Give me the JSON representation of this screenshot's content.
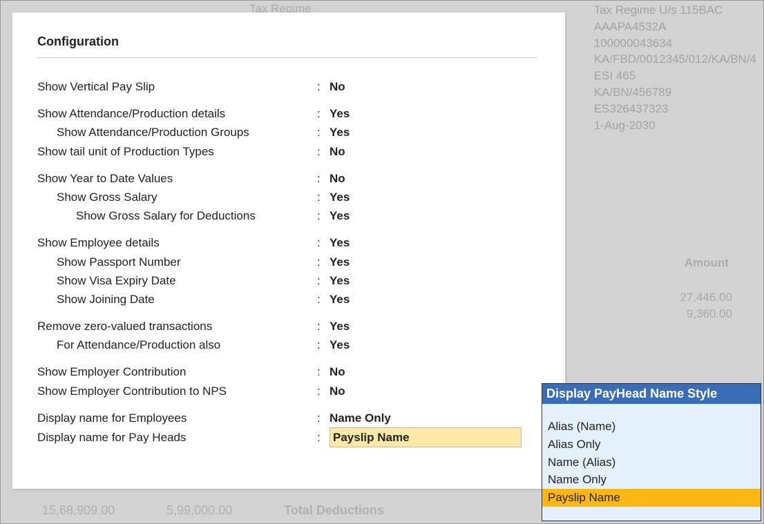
{
  "background": {
    "top_left_label": "Tax Regime",
    "right_lines": [
      "Tax Regime U/s 115BAC",
      "AAAPA4532A",
      "100000043634",
      "KA/FBD/0012345/012/KA/BN/4",
      "ESI 465",
      "KA/BN/456789",
      "ES326437323",
      "1-Aug-2030"
    ],
    "amount_header": "Amount",
    "amounts": [
      "27,446.00",
      "9,360.00"
    ],
    "bottom": {
      "a": "15,68,909.00",
      "b": "5,99,000.00",
      "label": "Total Deductions"
    }
  },
  "modal": {
    "title": "Configuration",
    "rows": [
      {
        "label": "Show Vertical Pay Slip",
        "value": "No",
        "indent": 0,
        "gap": false
      },
      {
        "label": "Show Attendance/Production details",
        "value": "Yes",
        "indent": 0,
        "gap": true
      },
      {
        "label": "Show Attendance/Production Groups",
        "value": "Yes",
        "indent": 1,
        "gap": false
      },
      {
        "label": "Show tail unit of Production Types",
        "value": "No",
        "indent": 0,
        "gap": false
      },
      {
        "label": "Show Year to Date Values",
        "value": "No",
        "indent": 0,
        "gap": true
      },
      {
        "label": "Show Gross Salary",
        "value": "Yes",
        "indent": 1,
        "gap": false
      },
      {
        "label": "Show Gross Salary for Deductions",
        "value": "Yes",
        "indent": 2,
        "gap": false
      },
      {
        "label": "Show Employee details",
        "value": "Yes",
        "indent": 0,
        "gap": true
      },
      {
        "label": "Show Passport Number",
        "value": "Yes",
        "indent": 1,
        "gap": false
      },
      {
        "label": "Show Visa Expiry Date",
        "value": "Yes",
        "indent": 1,
        "gap": false
      },
      {
        "label": "Show Joining Date",
        "value": "Yes",
        "indent": 1,
        "gap": false
      },
      {
        "label": "Remove zero-valued transactions",
        "value": "Yes",
        "indent": 0,
        "gap": true
      },
      {
        "label": "For Attendance/Production also",
        "value": "Yes",
        "indent": 1,
        "gap": false
      },
      {
        "label": "Show Employer Contribution",
        "value": "No",
        "indent": 0,
        "gap": true
      },
      {
        "label": "Show Employer Contribution to NPS",
        "value": "No",
        "indent": 0,
        "gap": false
      },
      {
        "label": "Display name for Employees",
        "value": "Name Only",
        "indent": 0,
        "gap": true
      },
      {
        "label": "Display name for Pay Heads",
        "value": "Payslip Name",
        "indent": 0,
        "gap": false,
        "is_input": true
      }
    ]
  },
  "popup": {
    "title": "Display PayHead Name Style",
    "items": [
      {
        "label": "Alias (Name)",
        "selected": false
      },
      {
        "label": "Alias Only",
        "selected": false
      },
      {
        "label": "Name (Alias)",
        "selected": false
      },
      {
        "label": "Name Only",
        "selected": false
      },
      {
        "label": "Payslip Name",
        "selected": true
      }
    ]
  }
}
